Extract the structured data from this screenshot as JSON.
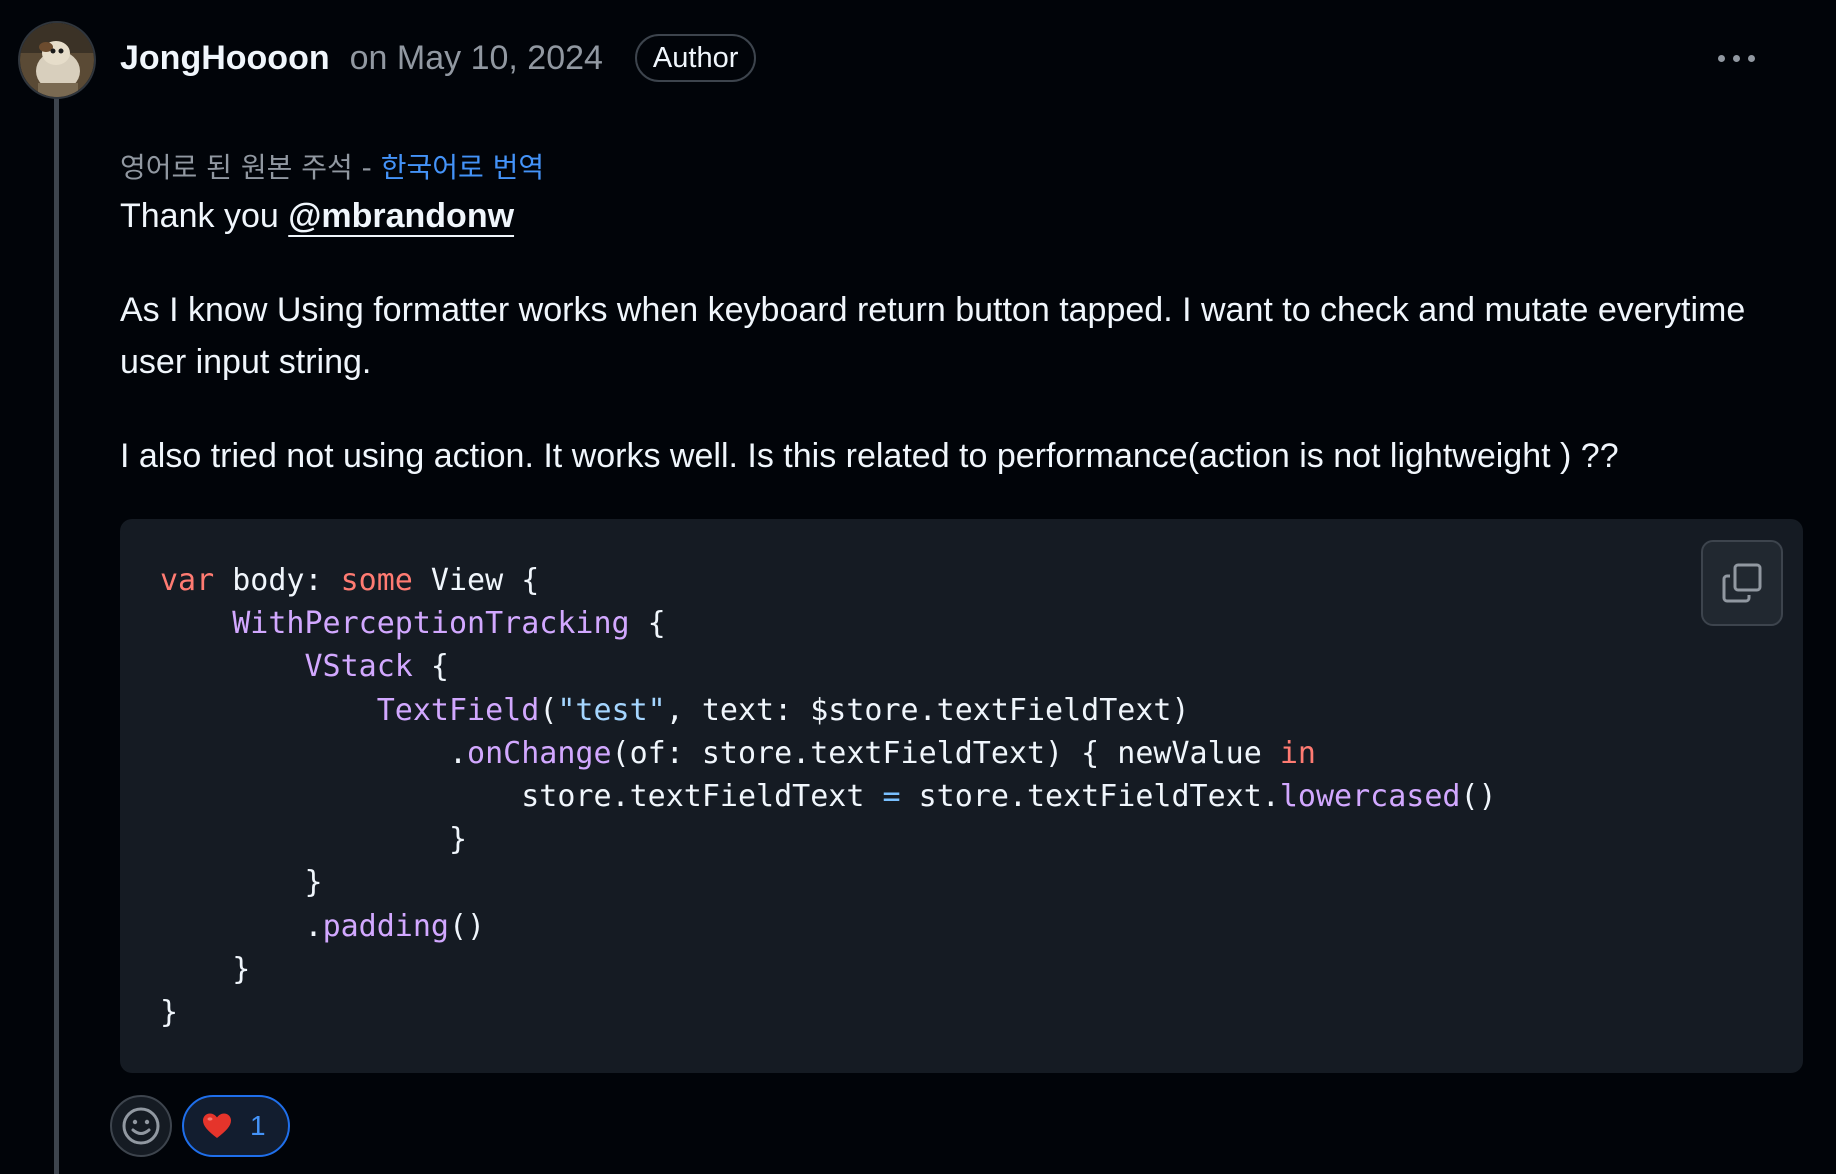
{
  "comment": {
    "author": "JongHoooon",
    "date": "on May 10, 2024",
    "badge": "Author",
    "translation": {
      "note": "영어로 된 원본 주석 - ",
      "link": "한국어로 번역"
    },
    "greeting_prefix": "Thank you ",
    "mention": "@mbrandonw",
    "paragraph_1": "As I know Using formatter works when keyboard return button tapped. I want to check and mutate everytime user input string.",
    "paragraph_2": "I also tried not using action. It works well. Is this related to performance(action is not lightweight ) ??"
  },
  "code": {
    "line_1": [
      "var",
      " body: ",
      "some",
      " View {"
    ],
    "line_2": [
      "    ",
      "WithPerceptionTracking",
      " {"
    ],
    "line_3": [
      "        ",
      "VStack",
      " {"
    ],
    "line_4": [
      "            ",
      "TextField",
      "(",
      "\"test\"",
      ", text: $store.textFieldText)"
    ],
    "line_5": [
      "                .",
      "onChange",
      "(of: store.textFieldText) { newValue ",
      "in"
    ],
    "line_6": [
      "                    store.textFieldText ",
      "=",
      " store.textFieldText.",
      "lowercased",
      "()"
    ],
    "line_7": "                }",
    "line_8": "        }",
    "line_9": [
      "        .",
      "padding",
      "()"
    ],
    "line_10": "    }",
    "line_11": "}"
  },
  "reactions": {
    "heart_emoji": "❤️",
    "heart_count": "1"
  },
  "icons": {
    "more": "kebab-horizontal-icon",
    "copy": "copy-icon",
    "emoji_picker": "smiley-icon"
  },
  "colors": {
    "background": "#010409",
    "code_background": "#151b23",
    "link": "#4493f8",
    "keyword": "#ff7b72",
    "function": "#d2a8ff",
    "string": "#a5d6ff"
  }
}
